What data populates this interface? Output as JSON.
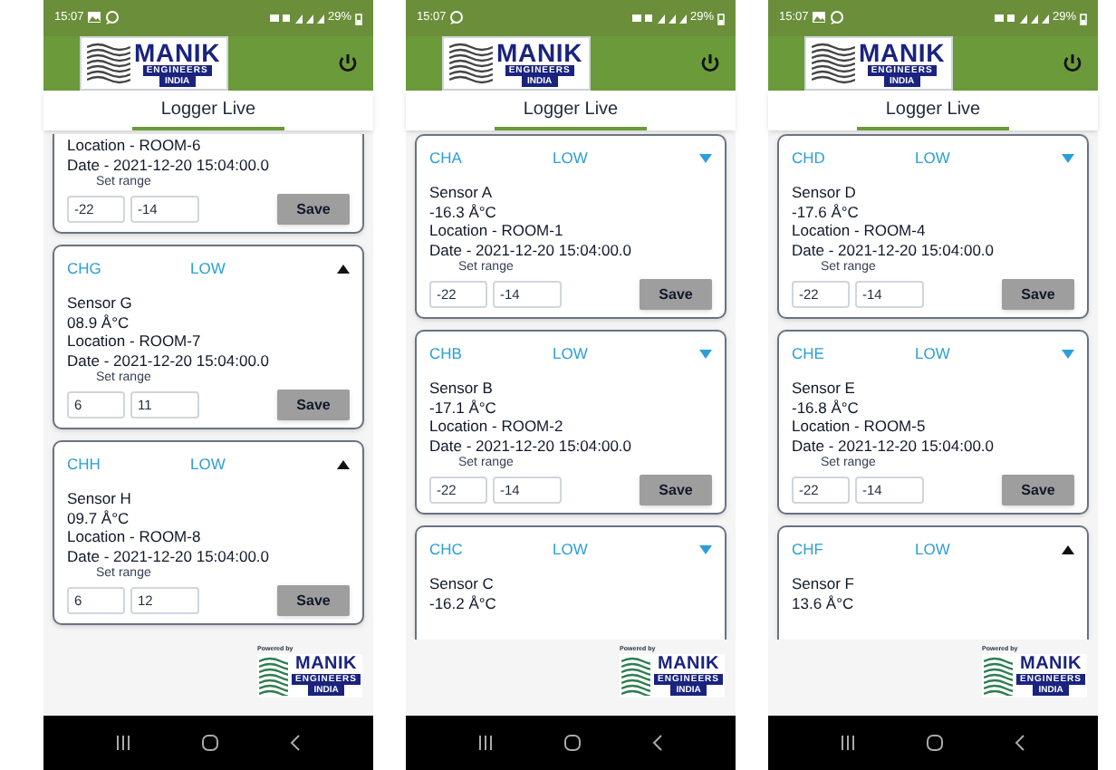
{
  "screens": [
    {
      "status_bar": {
        "time": "15:07",
        "notification_icons": [
          {
            "kind": "gallery"
          },
          {
            "kind": "chat"
          }
        ],
        "battery": "29%"
      },
      "logo": {
        "name": "MANIK",
        "line2": "ENGINEERS",
        "line3": "INDIA"
      },
      "tab": {
        "label": "Logger Live",
        "selected": true
      },
      "cards": [
        {
          "kind": "cut_top",
          "location": "Location - ROOM-6",
          "date": "Date - 2021-12-20 15:04:00.0",
          "range_label": "Set range",
          "range_min": "-22",
          "range_max": "-14",
          "save": "Save"
        },
        {
          "kind": "full",
          "channel": "CHG",
          "status": "LOW",
          "expanded": true,
          "sensor": "Sensor G",
          "temperature": "08.9 Å°C",
          "location": "Location - ROOM-7",
          "date": "Date - 2021-12-20 15:04:00.0",
          "range_label": "Set range",
          "range_min": "6",
          "range_max": "11",
          "save": "Save"
        },
        {
          "kind": "full",
          "channel": "CHH",
          "status": "LOW",
          "expanded": true,
          "sensor": "Sensor H",
          "temperature": "09.7 Å°C",
          "location": "Location - ROOM-8",
          "date": "Date - 2021-12-20 15:04:00.0",
          "range_label": "Set range",
          "range_min": "6",
          "range_max": "12",
          "save": "Save"
        }
      ],
      "footer": {
        "powered_by": "Powered by",
        "logo": {
          "name": "MANIK",
          "line2": "ENGINEERS",
          "line3": "INDIA"
        }
      }
    },
    {
      "status_bar": {
        "time": "15:07",
        "notification_icons": [
          {
            "kind": "chat"
          }
        ],
        "battery": "29%"
      },
      "logo": {
        "name": "MANIK",
        "line2": "ENGINEERS",
        "line3": "INDIA"
      },
      "tab": {
        "label": "Logger Live",
        "selected": true
      },
      "cards": [
        {
          "kind": "full",
          "channel": "CHA",
          "status": "LOW",
          "expanded": false,
          "sensor": "Sensor A",
          "temperature": "-16.3 Å°C",
          "location": "Location - ROOM-1",
          "date": "Date - 2021-12-20 15:04:00.0",
          "range_label": "Set range",
          "range_min": "-22",
          "range_max": "-14",
          "save": "Save"
        },
        {
          "kind": "full",
          "channel": "CHB",
          "status": "LOW",
          "expanded": false,
          "sensor": "Sensor B",
          "temperature": "-17.1 Å°C",
          "location": "Location - ROOM-2",
          "date": "Date - 2021-12-20 15:04:00.0",
          "range_label": "Set range",
          "range_min": "-22",
          "range_max": "-14",
          "save": "Save"
        },
        {
          "kind": "cut_bottom",
          "channel": "CHC",
          "status": "LOW",
          "expanded": false,
          "sensor": "Sensor C",
          "temperature": "-16.2 Å°C"
        }
      ],
      "footer": {
        "powered_by": "Powered by",
        "logo": {
          "name": "MANIK",
          "line2": "ENGINEERS",
          "line3": "INDIA"
        }
      }
    },
    {
      "status_bar": {
        "time": "15:07",
        "notification_icons": [
          {
            "kind": "gallery"
          },
          {
            "kind": "chat"
          }
        ],
        "battery": "29%"
      },
      "logo": {
        "name": "MANIK",
        "line2": "ENGINEERS",
        "line3": "INDIA"
      },
      "tab": {
        "label": "Logger Live",
        "selected": true
      },
      "cards": [
        {
          "kind": "full",
          "channel": "CHD",
          "status": "LOW",
          "expanded": false,
          "sensor": "Sensor D",
          "temperature": "-17.6 Å°C",
          "location": "Location - ROOM-4",
          "date": "Date - 2021-12-20 15:04:00.0",
          "range_label": "Set range",
          "range_min": "-22",
          "range_max": "-14",
          "save": "Save"
        },
        {
          "kind": "full",
          "channel": "CHE",
          "status": "LOW",
          "expanded": false,
          "sensor": "Sensor E",
          "temperature": "-16.8 Å°C",
          "location": "Location - ROOM-5",
          "date": "Date - 2021-12-20 15:04:00.0",
          "range_label": "Set range",
          "range_min": "-22",
          "range_max": "-14",
          "save": "Save"
        },
        {
          "kind": "cut_bottom",
          "channel": "CHF",
          "status": "LOW",
          "expanded": true,
          "sensor": "Sensor F",
          "temperature": "13.6 Å°C"
        }
      ],
      "footer": {
        "powered_by": "Powered by",
        "logo": {
          "name": "MANIK",
          "line2": "ENGINEERS",
          "line3": "INDIA"
        }
      }
    }
  ]
}
